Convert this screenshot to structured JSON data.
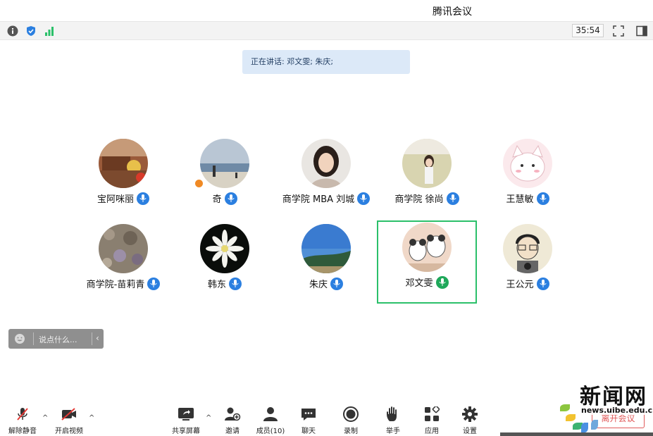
{
  "window": {
    "title": "腾讯会议"
  },
  "top_toolbar": {
    "timer": "35:54"
  },
  "speaking_banner": "正在讲话: 邓文雯; 朱庆;",
  "participants": [
    {
      "name": "宝阿咪丽"
    },
    {
      "name": "奇"
    },
    {
      "name": "商学院 MBA 刘城"
    },
    {
      "name": "商学院 徐尚"
    },
    {
      "name": "王慧敏"
    },
    {
      "name": "商学院-苗莉青"
    },
    {
      "name": "韩东"
    },
    {
      "name": "朱庆"
    },
    {
      "name": "邓文雯"
    },
    {
      "name": "王公元"
    }
  ],
  "chat": {
    "placeholder": "说点什么..."
  },
  "bottom_toolbar": {
    "unmute": "解除静音",
    "video": "开启视频",
    "share": "共享屏幕",
    "invite": "邀请",
    "members": "成员(10)",
    "chat": "聊天",
    "record": "录制",
    "raise_hand": "举手",
    "apps": "应用",
    "settings": "设置",
    "leave": "离开会议"
  },
  "watermark": {
    "big": "新闻网",
    "small": "news.uibe.edu.cn"
  },
  "colors": {
    "accent": "#2b7fe0",
    "active_border": "#2bc06a",
    "leave": "#e05a5a",
    "banner": "#dce9f8"
  }
}
